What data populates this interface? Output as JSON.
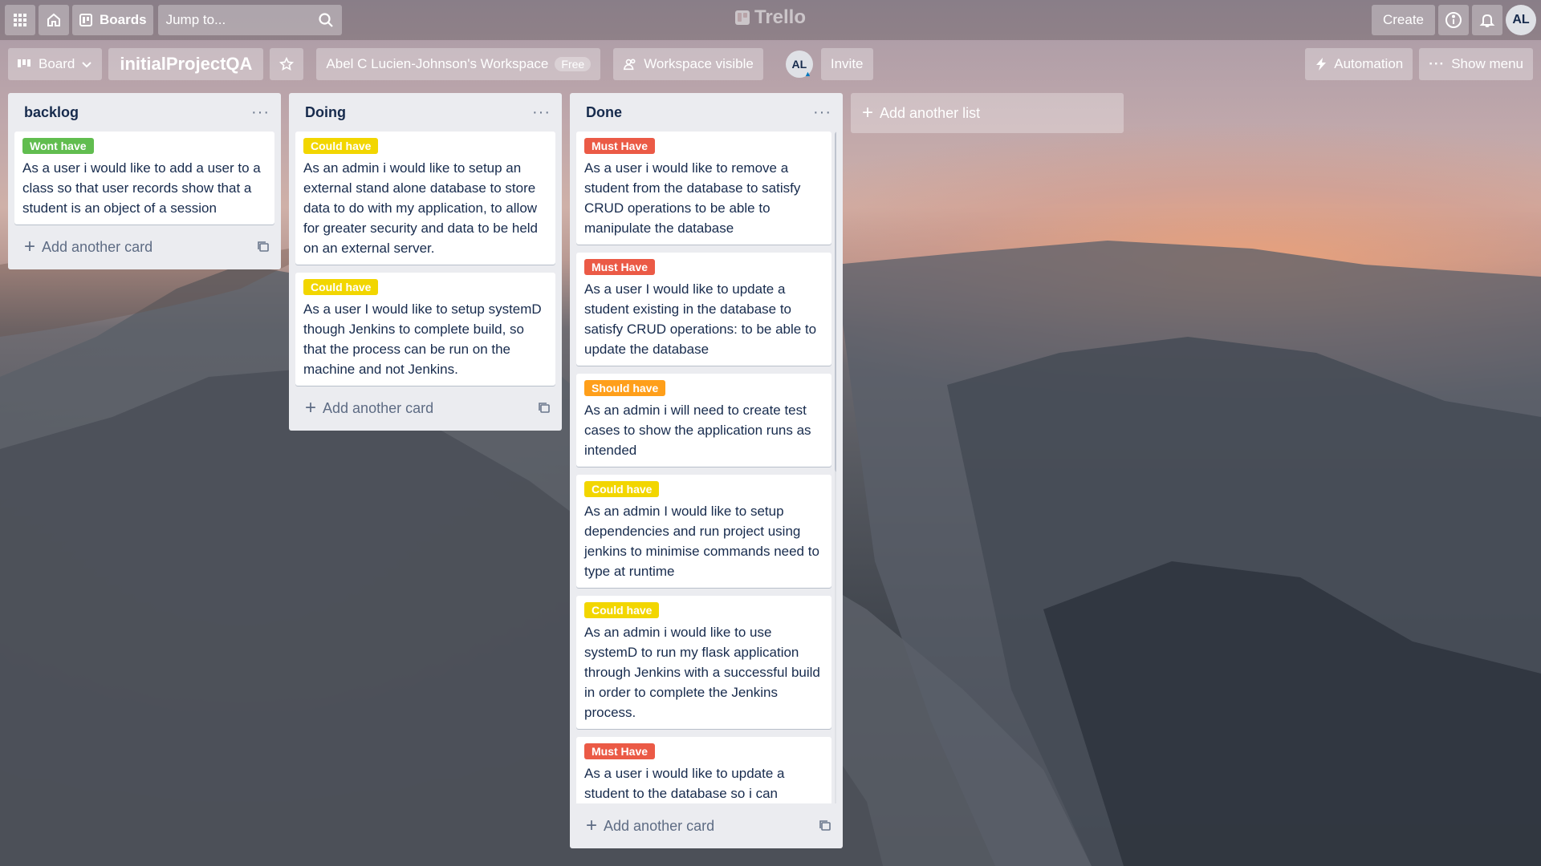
{
  "header": {
    "boards_label": "Boards",
    "search_placeholder": "Jump to...",
    "logo_text": "Trello",
    "create_label": "Create",
    "user_initials": "AL"
  },
  "board": {
    "view_label": "Board",
    "title": "initialProjectQA",
    "workspace_name": "Abel C Lucien-Johnson's Workspace",
    "workspace_plan": "Free",
    "visibility_label": "Workspace visible",
    "member_initials": "AL",
    "invite_label": "Invite",
    "automation_label": "Automation",
    "show_menu_label": "Show menu"
  },
  "label_colors": {
    "green": "#61bd4f",
    "yellow": "#f2d600",
    "red": "#eb5a46",
    "orange": "#ff9f1a"
  },
  "lists": [
    {
      "title": "backlog",
      "add_card_label": "Add another card",
      "cards": [
        {
          "label": "Wont have",
          "label_color": "green",
          "text": "As a user i would like to add a user to a class so that user records show that a student is an object of a session"
        }
      ]
    },
    {
      "title": "Doing",
      "add_card_label": "Add another card",
      "cards": [
        {
          "label": "Could have",
          "label_color": "yellow",
          "text": "As an admin i would like to setup an external stand alone database to store data to do with my application, to allow for greater security and data to be held on an external server."
        },
        {
          "label": "Could have",
          "label_color": "yellow",
          "text": "As a user I would like to setup systemD though Jenkins to complete build, so that the process can be run on the machine and not Jenkins."
        }
      ]
    },
    {
      "title": "Done",
      "add_card_label": "Add another card",
      "cards": [
        {
          "label": "Must Have",
          "label_color": "red",
          "text": "As a user i would like to remove a student from the database to satisfy CRUD operations to be able to manipulate the database"
        },
        {
          "label": "Must Have",
          "label_color": "red",
          "text": "As a user I would like to update a student existing in the database to satisfy CRUD operations: to be able to update the database"
        },
        {
          "label": "Should have",
          "label_color": "orange",
          "text": "As an admin i will need to create test cases to show the application runs as intended"
        },
        {
          "label": "Could have",
          "label_color": "yellow",
          "text": "As an admin I would like to setup dependencies and run project using jenkins to minimise commands need to type at runtime"
        },
        {
          "label": "Could have",
          "label_color": "yellow",
          "text": "As an admin i would like to use systemD to run my flask application through Jenkins with a successful build in order to complete the Jenkins process."
        },
        {
          "label": "Must Have",
          "label_color": "red",
          "text": "As a user i would like to update a student to the database so i can proform CRUD operations to be able"
        }
      ]
    }
  ],
  "add_list_label": "Add another list"
}
